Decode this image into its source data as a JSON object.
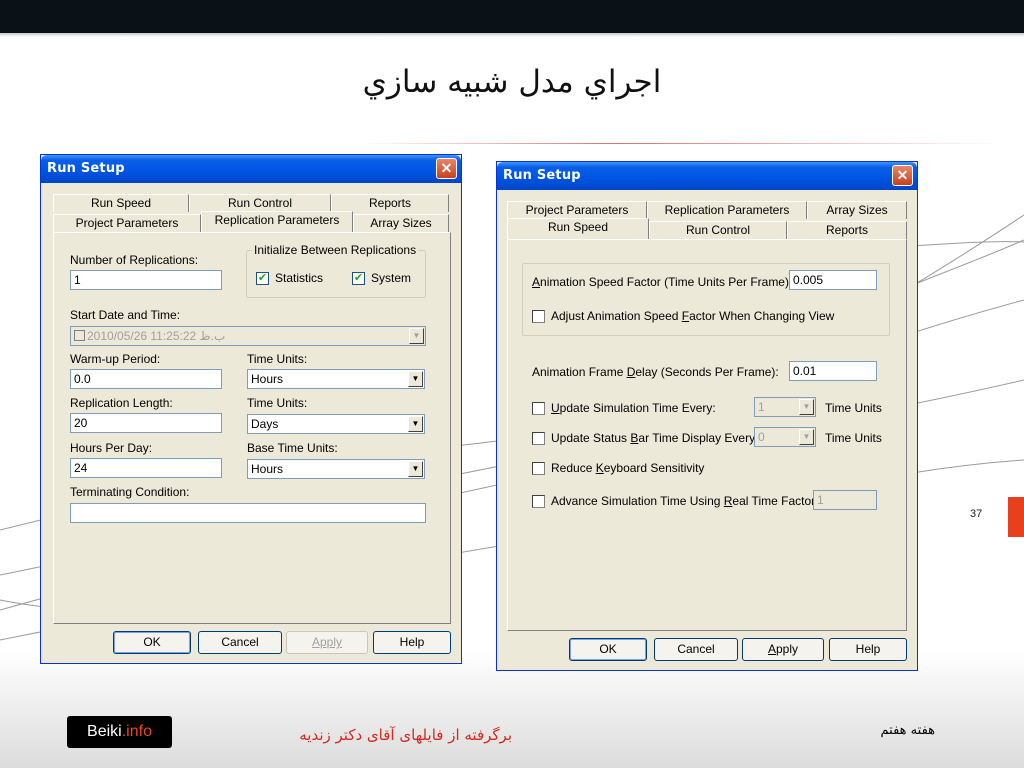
{
  "slide": {
    "title": "اجراي مدل شبيه سازي",
    "page_number": "37",
    "logo_main": "Beiki",
    "logo_domain": ".info",
    "credit": "برگرفته از فایلهای آقای دکتر زندیه",
    "week": "هفته هفتم"
  },
  "left_dialog": {
    "title": "Run Setup",
    "close": "✕",
    "tabs_back": [
      "Run Speed",
      "Run Control",
      "Reports"
    ],
    "tabs_front": [
      "Project Parameters",
      "Replication Parameters",
      "Array Sizes"
    ],
    "num_replications_label": "Number of Replications:",
    "num_replications_value": "1",
    "init_group_title": "Initialize Between Replications",
    "statistics_label": "Statistics",
    "system_label": "System",
    "statistics_checked": true,
    "system_checked": true,
    "start_date_label": "Start Date and Time:",
    "start_date_value": "2010/05/26  11:25:22 ب.ظ",
    "warmup_label": "Warm-up Period:",
    "warmup_value": "0.0",
    "time_units_label_1": "Time Units:",
    "time_units_value_1": "Hours",
    "rep_length_label": "Replication Length:",
    "rep_length_value": "20",
    "time_units_label_2": "Time Units:",
    "time_units_value_2": "Days",
    "hours_per_day_label": "Hours Per Day:",
    "hours_per_day_value": "24",
    "base_time_units_label": "Base Time Units:",
    "base_time_units_value": "Hours",
    "terminating_label": "Terminating Condition:",
    "terminating_value": "",
    "buttons": {
      "ok": "OK",
      "cancel": "Cancel",
      "apply": "Apply",
      "help": "Help"
    }
  },
  "right_dialog": {
    "title": "Run Setup",
    "close": "✕",
    "tabs_back": [
      "Project Parameters",
      "Replication Parameters",
      "Array Sizes"
    ],
    "tabs_front": [
      "Run Speed",
      "Run Control",
      "Reports"
    ],
    "anim_speed_label_pre": "A",
    "anim_speed_label_post": "nimation Speed Factor (Time Units Per Frame):",
    "anim_speed_value": "0.005",
    "adjust_pre": "Adjust Animation Speed ",
    "adjust_u": "F",
    "adjust_post": "actor When Changing View",
    "frame_delay_pre": "Animation Frame ",
    "frame_delay_u": "D",
    "frame_delay_post": "elay (Seconds Per Frame):",
    "frame_delay_value": "0.01",
    "update_sim_u": "U",
    "update_sim_post": "pdate Simulation Time Every:",
    "update_sim_value": "1",
    "time_units_1": "Time Units",
    "update_status_pre": "Update Status ",
    "update_status_u": "B",
    "update_status_post": "ar Time Display Every:",
    "update_status_value": "0",
    "time_units_2": "Time Units",
    "reduce_pre": "Reduce ",
    "reduce_u": "K",
    "reduce_post": "eyboard Sensitivity",
    "advance_pre": "Advance Simulation Time Using ",
    "advance_u": "R",
    "advance_post": "eal Time Factor:",
    "advance_value": "1",
    "buttons": {
      "ok": "OK",
      "cancel": "Cancel",
      "apply_u": "A",
      "apply_post": "pply",
      "help": "Help"
    }
  },
  "colors": {
    "accent_red": "#e8401c",
    "xp_blue": "#0055e5",
    "credit_red": "#d42a20"
  }
}
